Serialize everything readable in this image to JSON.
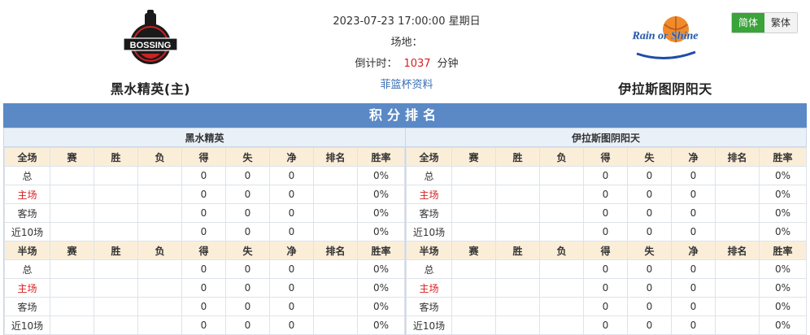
{
  "header": {
    "home_team": "黑水精英(主)",
    "away_team": "伊拉斯图阴阳天",
    "datetime": "2023-07-23 17:00:00 星期日",
    "venue_label": "场地：",
    "countdown_label": "倒计时：",
    "countdown_value": "1037",
    "countdown_unit": "分钟",
    "fiba_link": "菲篮杯资料",
    "home_logo_text": "BOSSING",
    "away_logo_text": "Rain or Shine"
  },
  "lang": {
    "simplified": "简体",
    "traditional": "繁体"
  },
  "standings": {
    "title": "积分排名",
    "columns": [
      "赛",
      "胜",
      "负",
      "得",
      "失",
      "净",
      "排名",
      "胜率"
    ],
    "full_label": "全场",
    "half_label": "半场",
    "panels": [
      {
        "team": "黑水精英",
        "full": [
          {
            "label": "总",
            "games": "",
            "win": "",
            "loss": "",
            "pts_for": "0",
            "pts_against": "0",
            "net": "0",
            "rank": "",
            "rate": "0%"
          },
          {
            "label": "主场",
            "games": "",
            "win": "",
            "loss": "",
            "pts_for": "0",
            "pts_against": "0",
            "net": "0",
            "rank": "",
            "rate": "0%"
          },
          {
            "label": "客场",
            "games": "",
            "win": "",
            "loss": "",
            "pts_for": "0",
            "pts_against": "0",
            "net": "0",
            "rank": "",
            "rate": "0%"
          },
          {
            "label": "近10场",
            "games": "",
            "win": "",
            "loss": "",
            "pts_for": "0",
            "pts_against": "0",
            "net": "0",
            "rank": "",
            "rate": "0%"
          }
        ],
        "half": [
          {
            "label": "总",
            "games": "",
            "win": "",
            "loss": "",
            "pts_for": "0",
            "pts_against": "0",
            "net": "0",
            "rank": "",
            "rate": "0%"
          },
          {
            "label": "主场",
            "games": "",
            "win": "",
            "loss": "",
            "pts_for": "0",
            "pts_against": "0",
            "net": "0",
            "rank": "",
            "rate": "0%"
          },
          {
            "label": "客场",
            "games": "",
            "win": "",
            "loss": "",
            "pts_for": "0",
            "pts_against": "0",
            "net": "0",
            "rank": "",
            "rate": "0%"
          },
          {
            "label": "近10场",
            "games": "",
            "win": "",
            "loss": "",
            "pts_for": "0",
            "pts_against": "0",
            "net": "0",
            "rank": "",
            "rate": "0%"
          }
        ]
      },
      {
        "team": "伊拉斯图阴阳天",
        "full": [
          {
            "label": "总",
            "games": "",
            "win": "",
            "loss": "",
            "pts_for": "0",
            "pts_against": "0",
            "net": "0",
            "rank": "",
            "rate": "0%"
          },
          {
            "label": "主场",
            "games": "",
            "win": "",
            "loss": "",
            "pts_for": "0",
            "pts_against": "0",
            "net": "0",
            "rank": "",
            "rate": "0%"
          },
          {
            "label": "客场",
            "games": "",
            "win": "",
            "loss": "",
            "pts_for": "0",
            "pts_against": "0",
            "net": "0",
            "rank": "",
            "rate": "0%"
          },
          {
            "label": "近10场",
            "games": "",
            "win": "",
            "loss": "",
            "pts_for": "0",
            "pts_against": "0",
            "net": "0",
            "rank": "",
            "rate": "0%"
          }
        ],
        "half": [
          {
            "label": "总",
            "games": "",
            "win": "",
            "loss": "",
            "pts_for": "0",
            "pts_against": "0",
            "net": "0",
            "rank": "",
            "rate": "0%"
          },
          {
            "label": "主场",
            "games": "",
            "win": "",
            "loss": "",
            "pts_for": "0",
            "pts_against": "0",
            "net": "0",
            "rank": "",
            "rate": "0%"
          },
          {
            "label": "客场",
            "games": "",
            "win": "",
            "loss": "",
            "pts_for": "0",
            "pts_against": "0",
            "net": "0",
            "rank": "",
            "rate": "0%"
          },
          {
            "label": "近10场",
            "games": "",
            "win": "",
            "loss": "",
            "pts_for": "0",
            "pts_against": "0",
            "net": "0",
            "rank": "",
            "rate": "0%"
          }
        ]
      }
    ]
  },
  "colors": {
    "title_bar": "#5a89c6",
    "section_head": "#fbeed9",
    "home_label": "#d62020",
    "countdown": "#d62020",
    "link": "#3a6fb5",
    "active_lang": "#3aa33a"
  }
}
